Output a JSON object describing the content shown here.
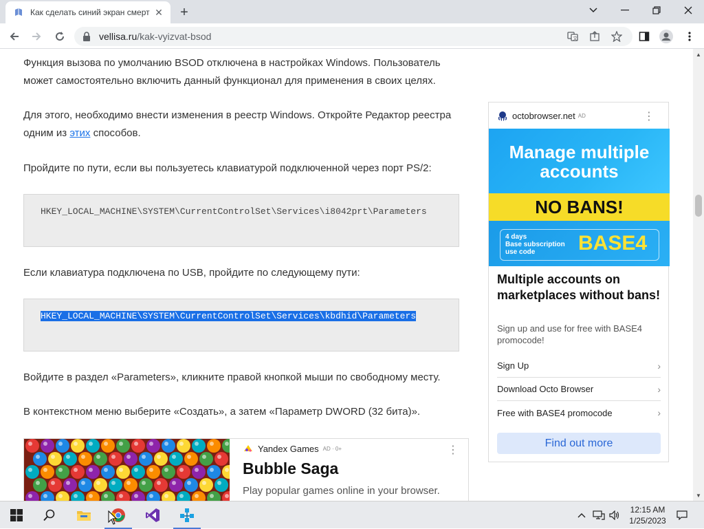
{
  "browser": {
    "tab_title": "Как сделать синий экран смерт",
    "tab_favicon": "book-icon",
    "url_host": "vellisa.ru",
    "url_path": "/kak-vyizvat-bsod",
    "window_controls": [
      "minimize",
      "restore",
      "close"
    ]
  },
  "article": {
    "p1": "Функция вызова по умолчанию BSOD отключена в настройках Windows. Пользователь может самостоятельно включить данный функционал для применения в своих целях.",
    "p2_before": "Для этого, необходимо внести изменения в реестр Windows. Откройте Редактор реестра одним из ",
    "p2_link": "этих",
    "p2_after": " способов.",
    "p3": "Пройдите по пути, если вы пользуетесь клавиатурой подключенной через порт PS/2:",
    "code1": "HKEY_LOCAL_MACHINE\\SYSTEM\\CurrentControlSet\\Services\\i8042prt\\Parameters",
    "p4": "Если клавиатура подключена по USB, пройдите по следующему пути:",
    "code2": "HKEY_LOCAL_MACHINE\\SYSTEM\\CurrentControlSet\\Services\\kbdhid\\Parameters",
    "p5": "Войдите в раздел «Parameters», кликните правой кнопкой мыши по свободному месту.",
    "p6": "В контекстном меню выберите «Создать», а затем «Параметр DWORD (32 бита)»."
  },
  "side_ad": {
    "source": "octobrowser.net",
    "ad_label": "AD",
    "banner_line1": "Manage multiple accounts",
    "banner_line2": "NO BANS!",
    "banner_small": "4 days\nBase subscription\nuse code",
    "banner_code": "BASE4",
    "title": "Multiple accounts on marketplaces without bans!",
    "desc": "Sign up and use for free with BASE4 promocode!",
    "links": [
      "Sign Up",
      "Download Octo Browser",
      "Free with BASE4 promocode"
    ],
    "cta": "Find out more"
  },
  "bottom_ad": {
    "source": "Yandex Games",
    "ad_label": "AD · 0+",
    "title": "Bubble Saga",
    "desc": "Play popular games online in your browser."
  },
  "taskbar": {
    "apps": [
      "windows-start-icon",
      "search-icon",
      "file-explorer-icon",
      "chrome-icon",
      "visual-studio-icon",
      "network-app-icon"
    ],
    "time": "12:15 AM",
    "date": "1/25/2023"
  },
  "colors": {
    "selection": "#1a6fe6",
    "link": "#1a73e8",
    "ad_blue": "#29b6f6",
    "ad_yellow": "#f6dc28"
  }
}
